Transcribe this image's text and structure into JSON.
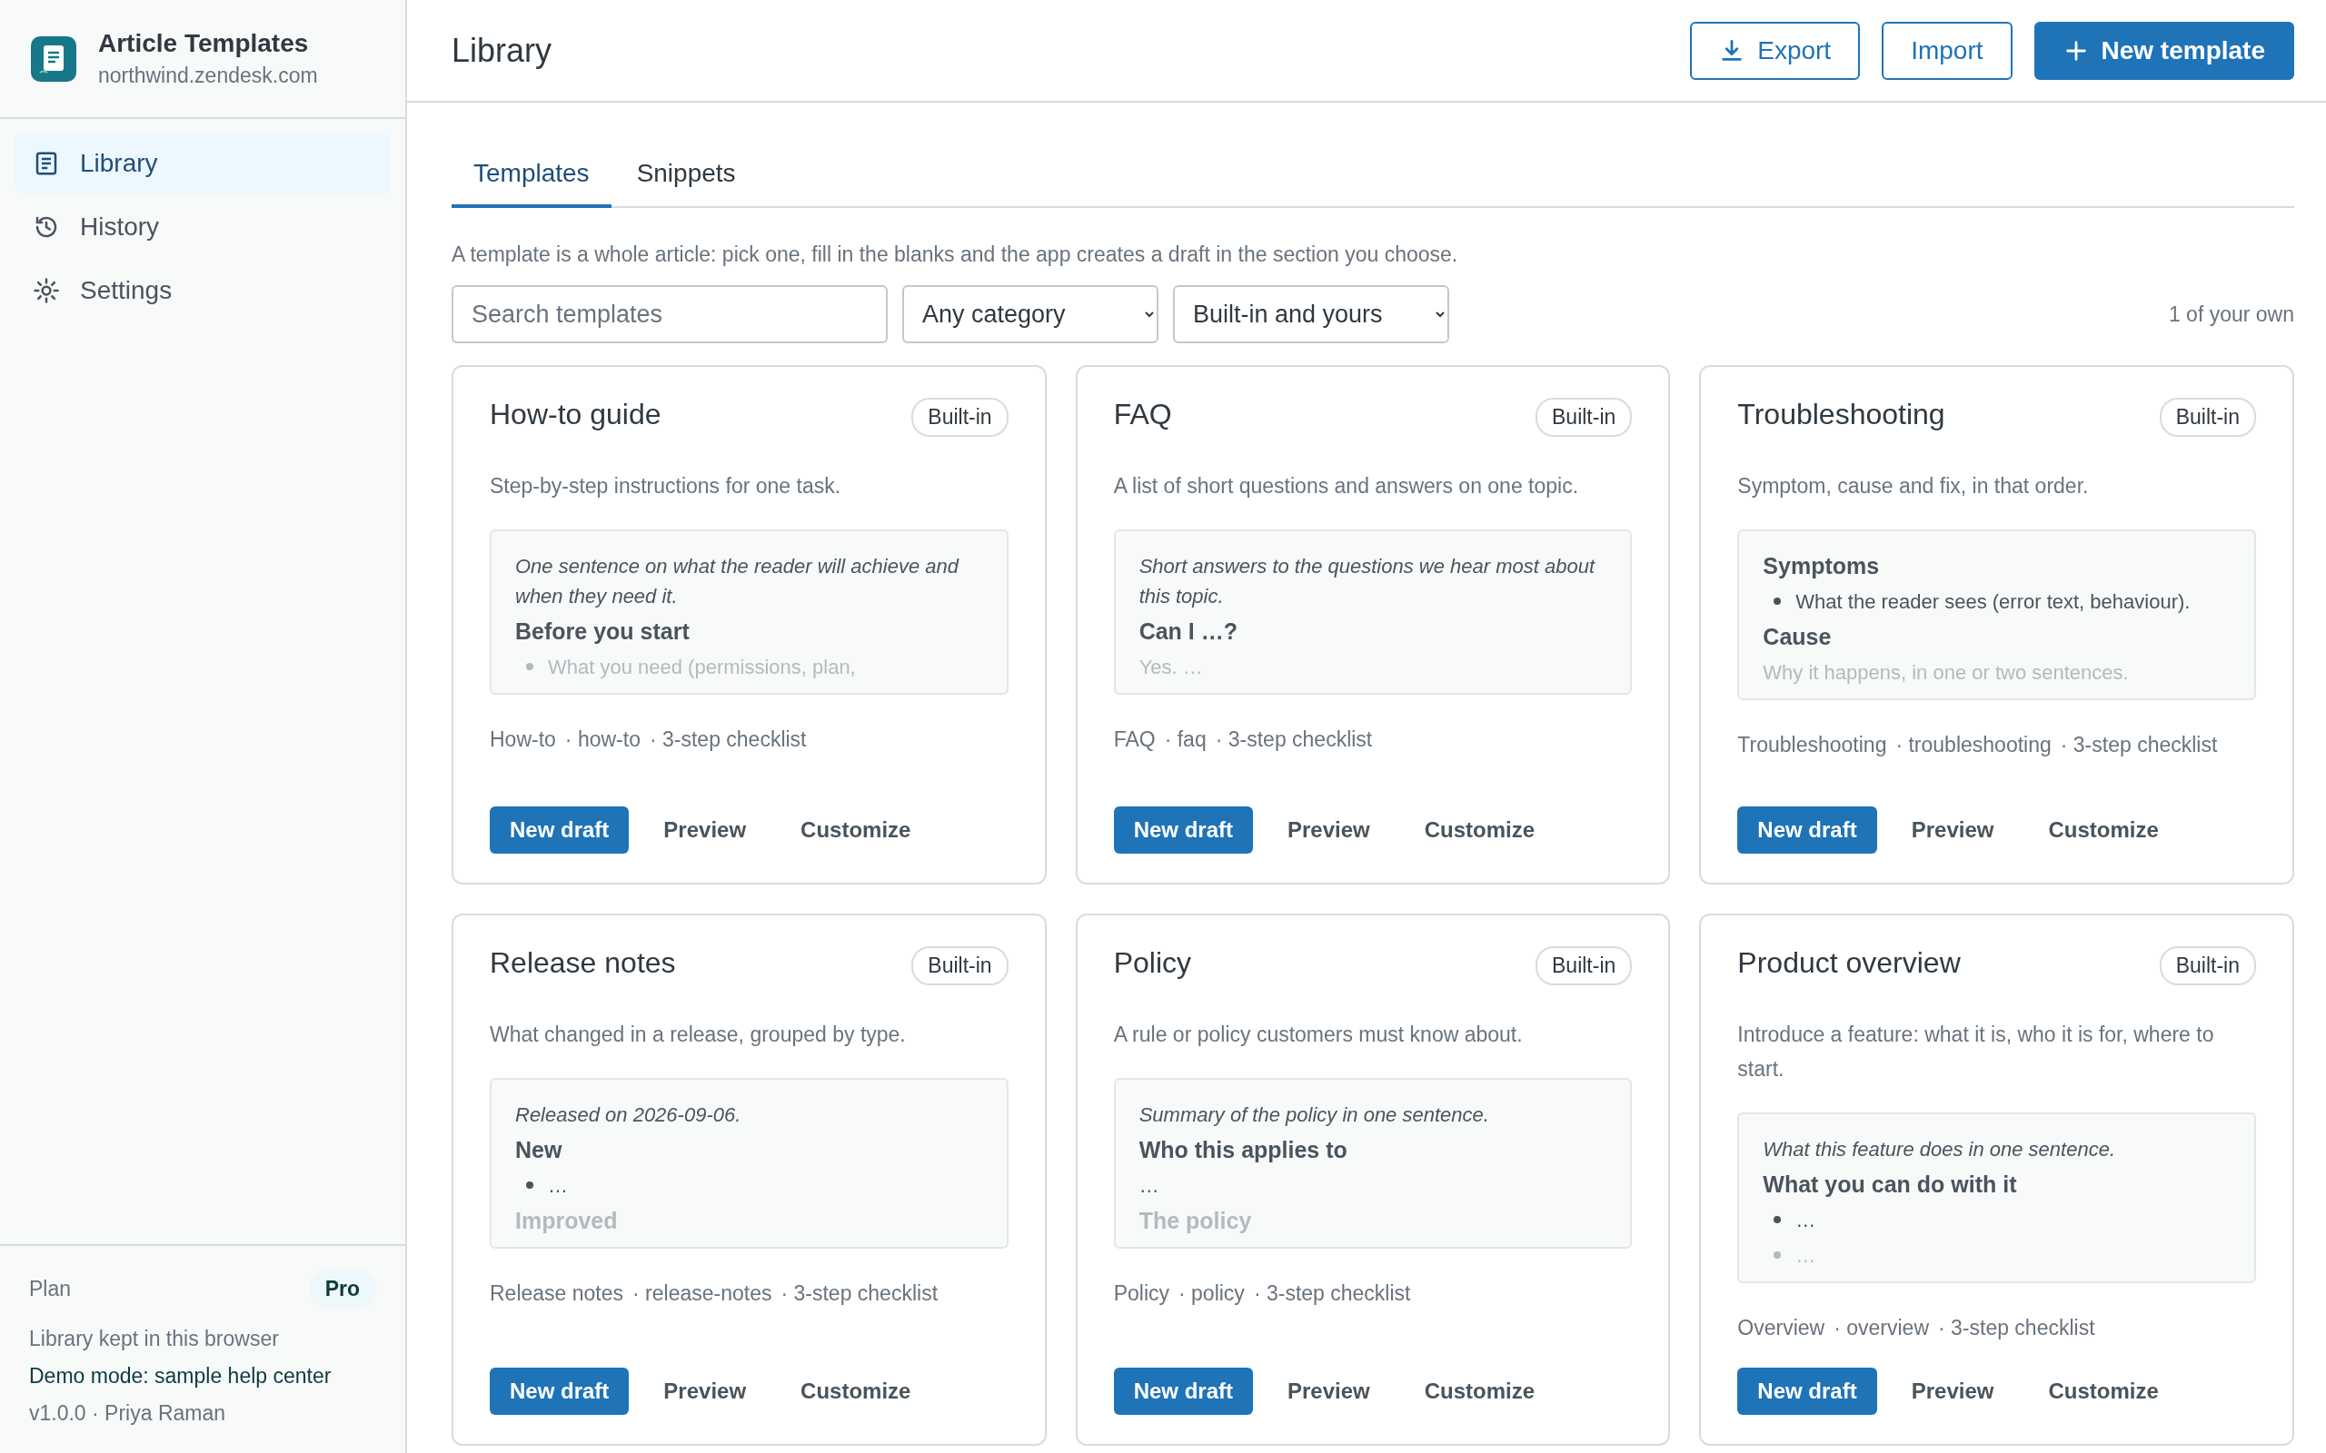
{
  "sidebar": {
    "app_title": "Article Templates",
    "app_subtitle": "northwind.zendesk.com",
    "items": [
      {
        "label": "Library",
        "kind": "library",
        "selected": true
      },
      {
        "label": "History",
        "kind": "history",
        "selected": false
      },
      {
        "label": "Settings",
        "kind": "settings",
        "selected": false
      }
    ],
    "footer": {
      "plan_label": "Plan",
      "plan_badge": "Pro",
      "storage_note": "Library kept in this browser",
      "demo_note": "Demo mode: sample help center",
      "version": "v1.0.0 · Priya Raman"
    }
  },
  "header": {
    "title": "Library",
    "buttons": [
      {
        "label": "Export",
        "kind": "export"
      },
      {
        "label": "Import",
        "kind": "import"
      },
      {
        "label": "New template",
        "kind": "new"
      }
    ]
  },
  "tabs": [
    {
      "label": "Templates",
      "selected": true
    },
    {
      "label": "Snippets",
      "selected": false
    }
  ],
  "intro": "A template is a whole article: pick one, fill in the blanks and the app creates a draft in the section you choose.",
  "filters": {
    "search": {
      "placeholder": "Search templates"
    },
    "category": "Any category",
    "source": "Built-in and yours",
    "count": "1 of your own"
  },
  "cards": [
    {
      "title": "How-to guide",
      "badge": "Built-in",
      "description": "Step-by-step instructions for one task.",
      "preview": [
        {
          "kind": "intro",
          "text": "One sentence on what the reader will achieve and when they need it.",
          "faded": false
        },
        {
          "kind": "heading",
          "text": "Before you start",
          "faded": false
        },
        {
          "kind": "bullet",
          "text": "What you need (permissions, plan,",
          "faded": true
        }
      ],
      "meta": [
        "How-to",
        "· how-to",
        "· 3-step checklist"
      ],
      "actions": [
        "New draft",
        "Preview",
        "Customize"
      ]
    },
    {
      "title": "FAQ",
      "badge": "Built-in",
      "description": "A list of short questions and answers on one topic.",
      "preview": [
        {
          "kind": "intro",
          "text": "Short answers to the questions we hear most about this topic.",
          "faded": false
        },
        {
          "kind": "heading",
          "text": "Can I …?",
          "faded": false
        },
        {
          "kind": "text",
          "text": "Yes. …",
          "faded": true
        }
      ],
      "meta": [
        "FAQ",
        "· faq",
        "· 3-step checklist"
      ],
      "actions": [
        "New draft",
        "Preview",
        "Customize"
      ]
    },
    {
      "title": "Troubleshooting",
      "badge": "Built-in",
      "description": "Symptom, cause and fix, in that order.",
      "preview": [
        {
          "kind": "heading",
          "text": "Symptoms",
          "faded": false
        },
        {
          "kind": "bullet",
          "text": "What the reader sees (error text, behaviour).",
          "faded": false
        },
        {
          "kind": "heading",
          "text": "Cause",
          "faded": false
        },
        {
          "kind": "text",
          "text": "Why it happens, in one or two sentences.",
          "faded": true
        }
      ],
      "meta": [
        "Troubleshooting",
        "· troubleshooting",
        "· 3-step checklist"
      ],
      "actions": [
        "New draft",
        "Preview",
        "Customize"
      ]
    },
    {
      "title": "Release notes",
      "badge": "Built-in",
      "description": "What changed in a release, grouped by type.",
      "preview": [
        {
          "kind": "intro",
          "text": "Released on 2026-09-06.",
          "faded": false
        },
        {
          "kind": "heading",
          "text": "New",
          "faded": false
        },
        {
          "kind": "bullet",
          "text": "…",
          "faded": false
        },
        {
          "kind": "heading",
          "text": "Improved",
          "faded": true
        }
      ],
      "meta": [
        "Release notes",
        "· release-notes",
        "· 3-step checklist"
      ],
      "actions": [
        "New draft",
        "Preview",
        "Customize"
      ]
    },
    {
      "title": "Policy",
      "badge": "Built-in",
      "description": "A rule or policy customers must know about.",
      "preview": [
        {
          "kind": "intro",
          "text": "Summary of the policy in one sentence.",
          "faded": false
        },
        {
          "kind": "heading",
          "text": "Who this applies to",
          "faded": false
        },
        {
          "kind": "text",
          "text": "…",
          "faded": false
        },
        {
          "kind": "heading",
          "text": "The policy",
          "faded": true
        }
      ],
      "meta": [
        "Policy",
        "· policy",
        "· 3-step checklist"
      ],
      "actions": [
        "New draft",
        "Preview",
        "Customize"
      ]
    },
    {
      "title": "Product overview",
      "badge": "Built-in",
      "description": "Introduce a feature: what it is, who it is for, where to start.",
      "preview": [
        {
          "kind": "intro",
          "text": "What this feature does in one sentence.",
          "faded": false
        },
        {
          "kind": "heading",
          "text": "What you can do with it",
          "faded": false
        },
        {
          "kind": "bullet",
          "text": "…",
          "faded": false
        },
        {
          "kind": "bullet",
          "text": "…",
          "faded": true
        }
      ],
      "meta": [
        "Overview",
        "· overview",
        "· 3-step checklist"
      ],
      "actions": [
        "New draft",
        "Preview",
        "Customize"
      ]
    }
  ]
}
